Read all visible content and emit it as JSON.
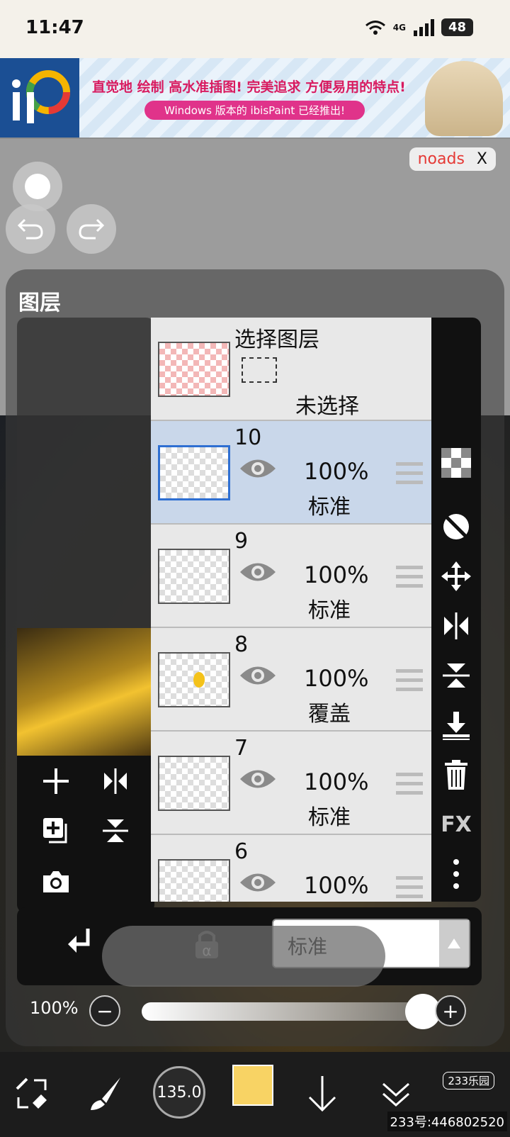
{
  "status_bar": {
    "time": "11:47",
    "network": "4G",
    "battery": "48"
  },
  "ad": {
    "headline": "直觉地 绘制 高水准插图! 完美追求 方便易用的特点!",
    "subline": "Windows 版本的 ibisPaint 已经推出!"
  },
  "noads": {
    "label": "noads",
    "close": "X"
  },
  "panel": {
    "title": "图层"
  },
  "selection_layer": {
    "title": "选择图层",
    "status": "未选择"
  },
  "layers": [
    {
      "num": "10",
      "opacity": "100%",
      "blend": "标准",
      "active": true
    },
    {
      "num": "9",
      "opacity": "100%",
      "blend": "标准",
      "active": false
    },
    {
      "num": "8",
      "opacity": "100%",
      "blend": "覆盖",
      "active": false
    },
    {
      "num": "7",
      "opacity": "100%",
      "blend": "标准",
      "active": false
    },
    {
      "num": "6",
      "opacity": "100%",
      "blend": "",
      "active": false
    }
  ],
  "right_toolbar": {
    "fx": "FX"
  },
  "blend_mode": {
    "value": "标准"
  },
  "opacity_slider": {
    "value": "100%",
    "minus": "−",
    "plus": "+"
  },
  "toolbar": {
    "brush_size": "135.0",
    "color": "#f8d364"
  },
  "watermark": {
    "logo": "233乐园",
    "text": "233号:446802520"
  }
}
